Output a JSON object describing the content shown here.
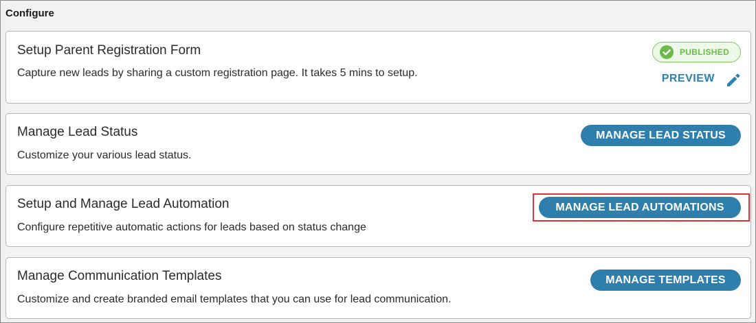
{
  "section": {
    "title": "Configure"
  },
  "cards": [
    {
      "title": "Setup Parent Registration Form",
      "description": "Capture new leads by sharing a custom registration page. It takes 5 mins to setup.",
      "badge": "PUBLISHED",
      "badge_icon": "check-circle-icon",
      "preview_label": "PREVIEW",
      "edit_icon": "pencil-icon"
    },
    {
      "title": "Manage Lead Status",
      "description": "Customize your various lead status.",
      "button_label": "MANAGE LEAD STATUS"
    },
    {
      "title": "Setup and Manage Lead Automation",
      "description": "Configure repetitive automatic actions for leads based on status change",
      "button_label": "MANAGE LEAD AUTOMATIONS",
      "highlighted": true
    },
    {
      "title": "Manage Communication Templates",
      "description": "Customize and create branded email templates that you can use for lead communication.",
      "button_label": "MANAGE TEMPLATES"
    }
  ],
  "colors": {
    "primary_button": "#2e7fac",
    "published_green": "#6cbb48",
    "highlight_red": "#e0313a"
  }
}
